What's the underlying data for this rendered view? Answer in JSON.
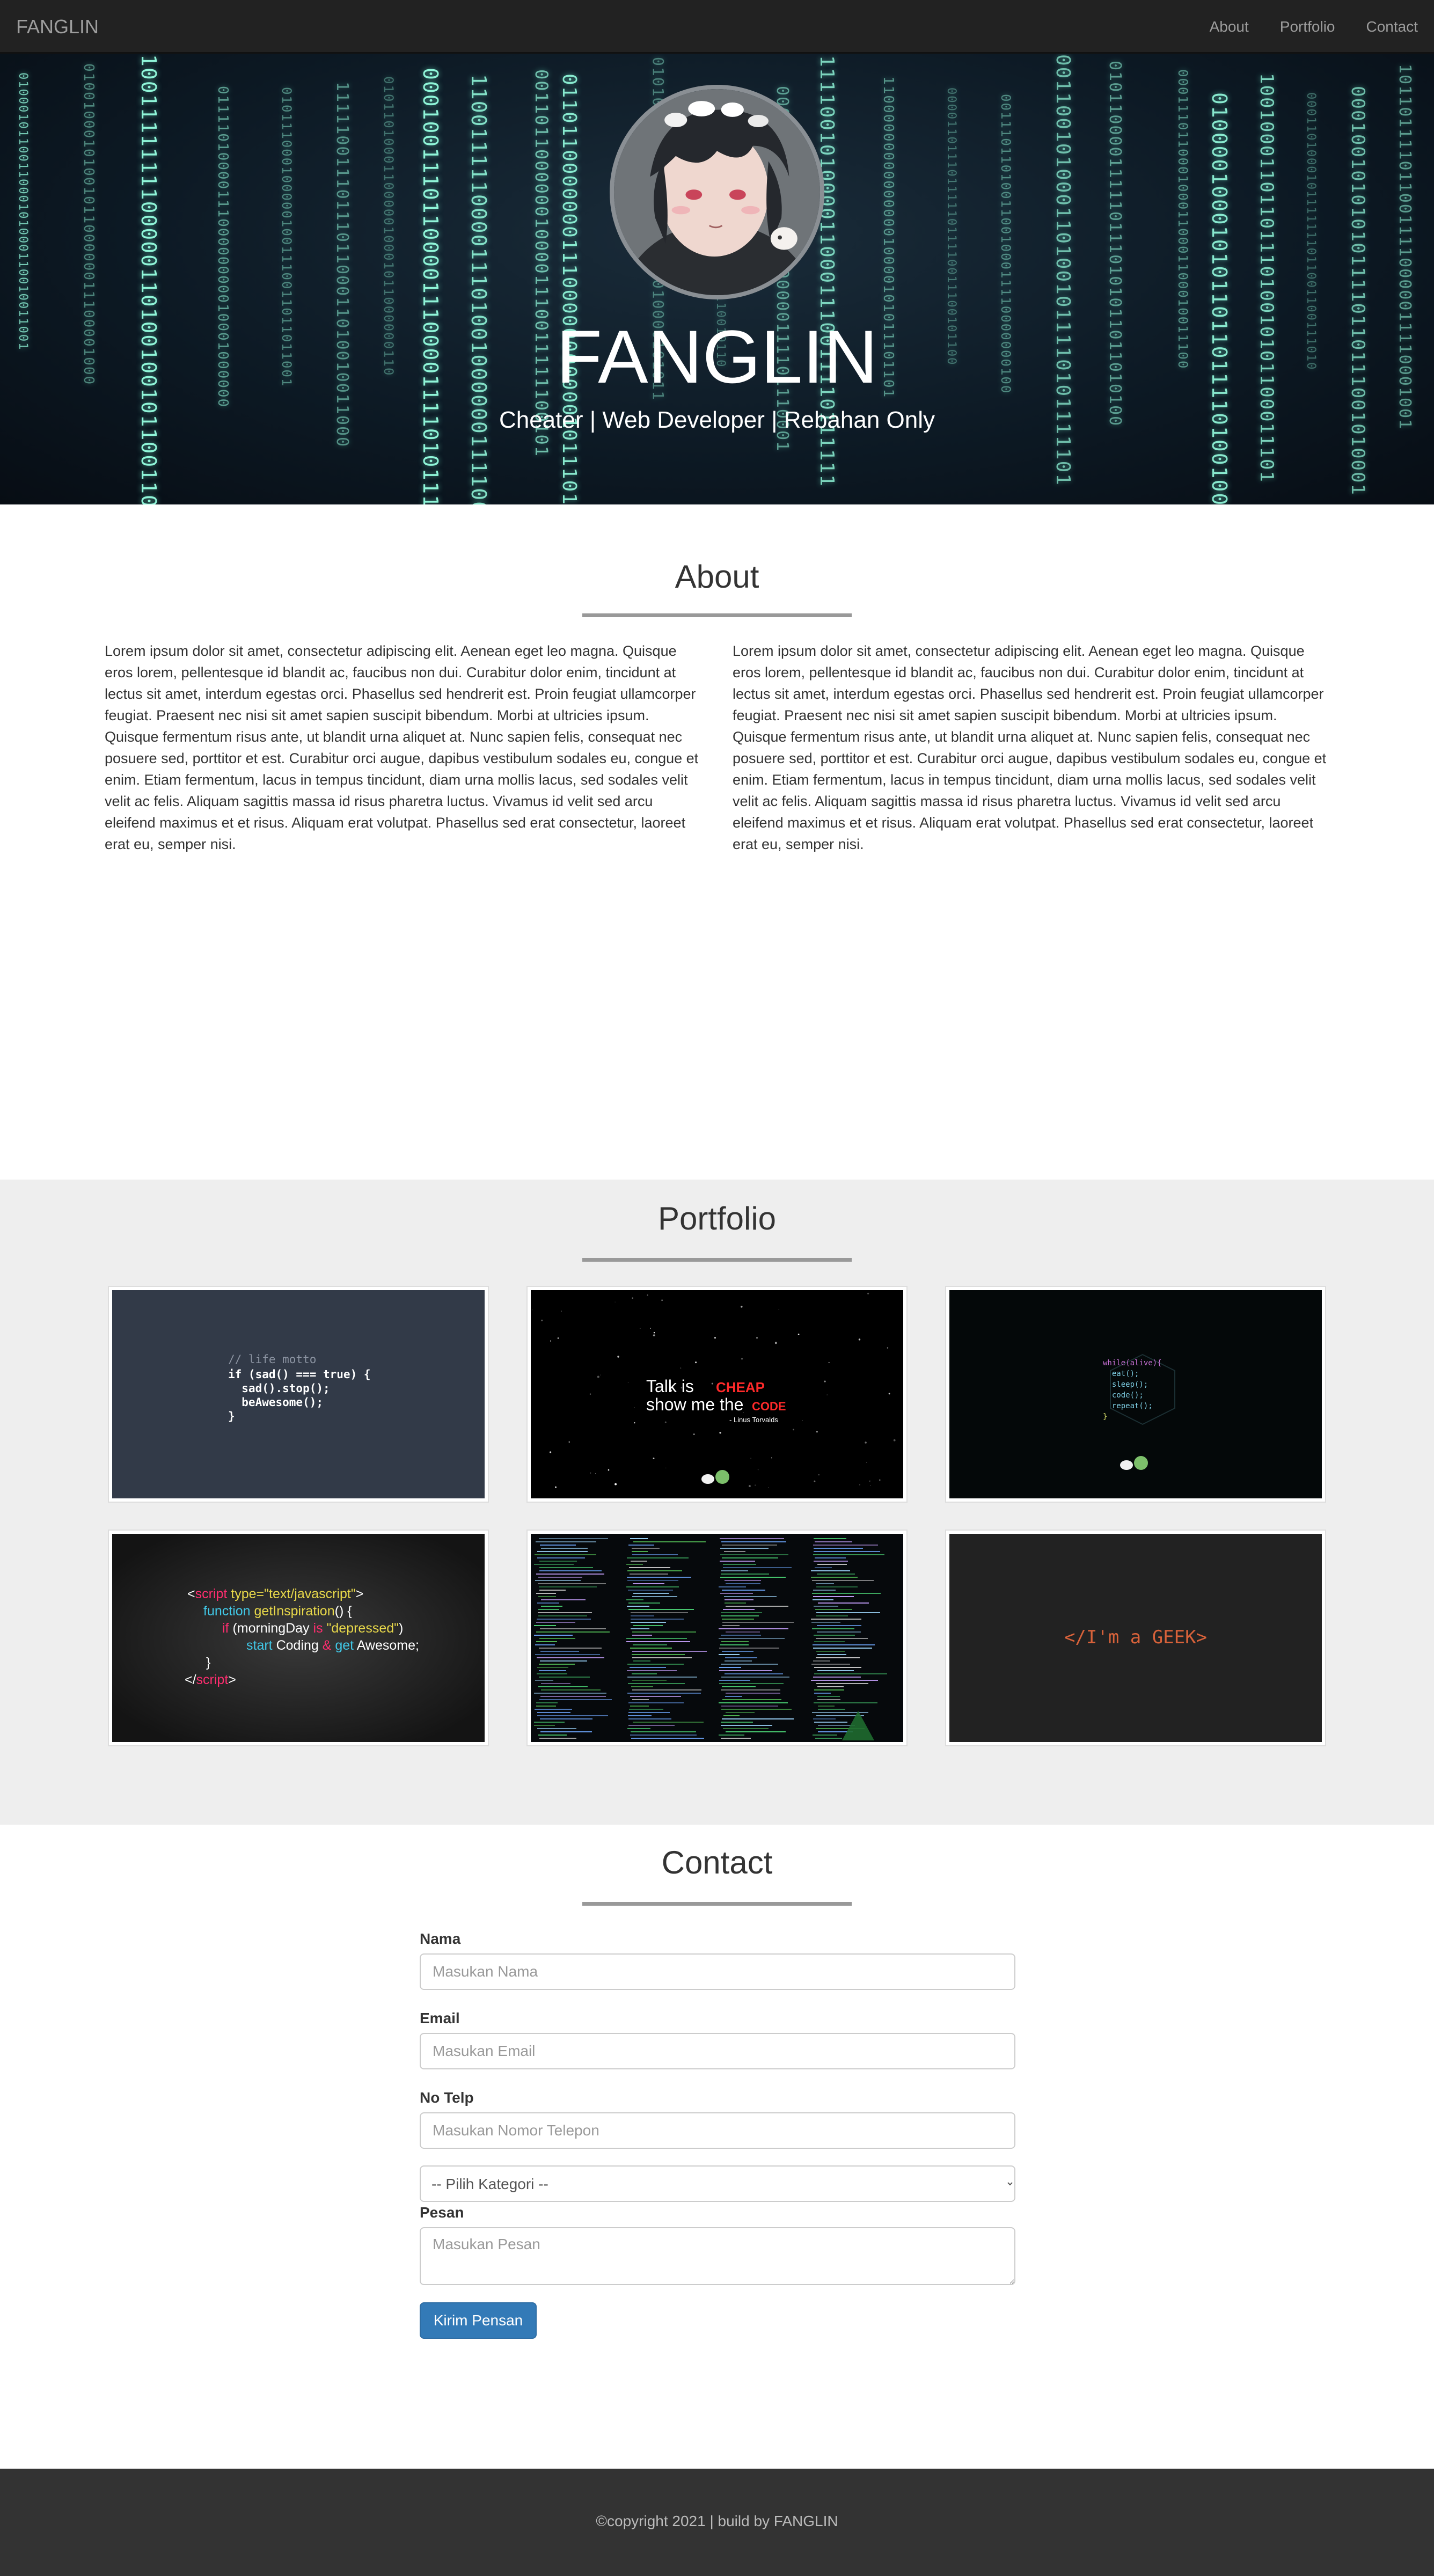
{
  "navbar": {
    "brand": "FANGLIN",
    "links": [
      "About",
      "Portfolio",
      "Contact"
    ]
  },
  "hero": {
    "title": "FANGLIN",
    "subtitle": "Cheater | Web Developer | Rebahan Only"
  },
  "about": {
    "title": "About",
    "paragraphs": [
      "Lorem ipsum dolor sit amet, consectetur adipiscing elit. Aenean eget leo magna. Quisque eros lorem, pellentesque id blandit ac, faucibus non dui. Curabitur dolor enim, tincidunt at lectus sit amet, interdum egestas orci. Phasellus sed hendrerit est. Proin feugiat ullamcorper feugiat. Praesent nec nisi sit amet sapien suscipit bibendum. Morbi at ultricies ipsum. Quisque fermentum risus ante, ut blandit urna aliquet at. Nunc sapien felis, consequat nec posuere sed, porttitor et est. Curabitur orci augue, dapibus vestibulum sodales eu, congue et enim. Etiam fermentum, lacus in tempus tincidunt, diam urna mollis lacus, sed sodales velit velit ac felis. Aliquam sagittis massa id risus pharetra luctus. Vivamus id velit sed arcu eleifend maximus et et risus. Aliquam erat volutpat. Phasellus sed erat consectetur, laoreet erat eu, semper nisi.",
      "Lorem ipsum dolor sit amet, consectetur adipiscing elit. Aenean eget leo magna. Quisque eros lorem, pellentesque id blandit ac, faucibus non dui. Curabitur dolor enim, tincidunt at lectus sit amet, interdum egestas orci. Phasellus sed hendrerit est. Proin feugiat ullamcorper feugiat. Praesent nec nisi sit amet sapien suscipit bibendum. Morbi at ultricies ipsum. Quisque fermentum risus ante, ut blandit urna aliquet at. Nunc sapien felis, consequat nec posuere sed, porttitor et est. Curabitur orci augue, dapibus vestibulum sodales eu, congue et enim. Etiam fermentum, lacus in tempus tincidunt, diam urna mollis lacus, sed sodales velit velit ac felis. Aliquam sagittis massa id risus pharetra luctus. Vivamus id velit sed arcu eleifend maximus et et risus. Aliquam erat volutpat. Phasellus sed erat consectetur, laoreet erat eu, semper nisi."
    ]
  },
  "portfolio": {
    "title": "Portfolio",
    "items": {
      "motto": {
        "comment": "// life motto",
        "lines": [
          "if (sad() === true) {",
          "  sad().stop();",
          "  beAwesome();",
          "}"
        ]
      },
      "talk": {
        "line1a": "Talk is ",
        "line1b": "CHEAP",
        "line2a": "show me the ",
        "line2b": "CODE",
        "author": "- Linus Torvalds"
      },
      "loop": {
        "lines": [
          "while(alive){",
          "  eat();",
          "  sleep();",
          "  code();",
          "  repeat();",
          "}"
        ]
      },
      "script": {
        "lines": [
          [
            "<",
            "script",
            " type=",
            "\"text/javascript\"",
            ">"
          ],
          [
            "function ",
            "getInspiration",
            "() {"
          ],
          [
            "if ",
            "(morningDay ",
            "is ",
            "\"depressed\"",
            ")"
          ],
          [
            "start ",
            "Coding ",
            "& ",
            "get ",
            "Awesome;"
          ],
          [
            "}"
          ],
          [
            "</",
            "script",
            ">"
          ]
        ]
      },
      "terminal": {},
      "geek": {
        "text": "</I'm a GEEK>"
      }
    }
  },
  "contact": {
    "title": "Contact",
    "name_label": "Nama",
    "name_placeholder": "Masukan Nama",
    "email_label": "Email",
    "email_placeholder": "Masukan Email",
    "phone_label": "No Telp",
    "phone_placeholder": "Masukan Nomor Telepon",
    "category_selected": "-- Pilih Kategori --",
    "message_label": "Pesan",
    "message_placeholder": "Masukan Pesan",
    "submit_label": "Kirim Pensan"
  },
  "footer": {
    "text": "©copyright 2021 | build by FANGLIN"
  },
  "colors": {
    "navbar": "#222222",
    "hero_digits": "#8ff5d8",
    "button": "#337ab7",
    "portfolio_bg": "#eeeeee",
    "footer": "#333333"
  }
}
